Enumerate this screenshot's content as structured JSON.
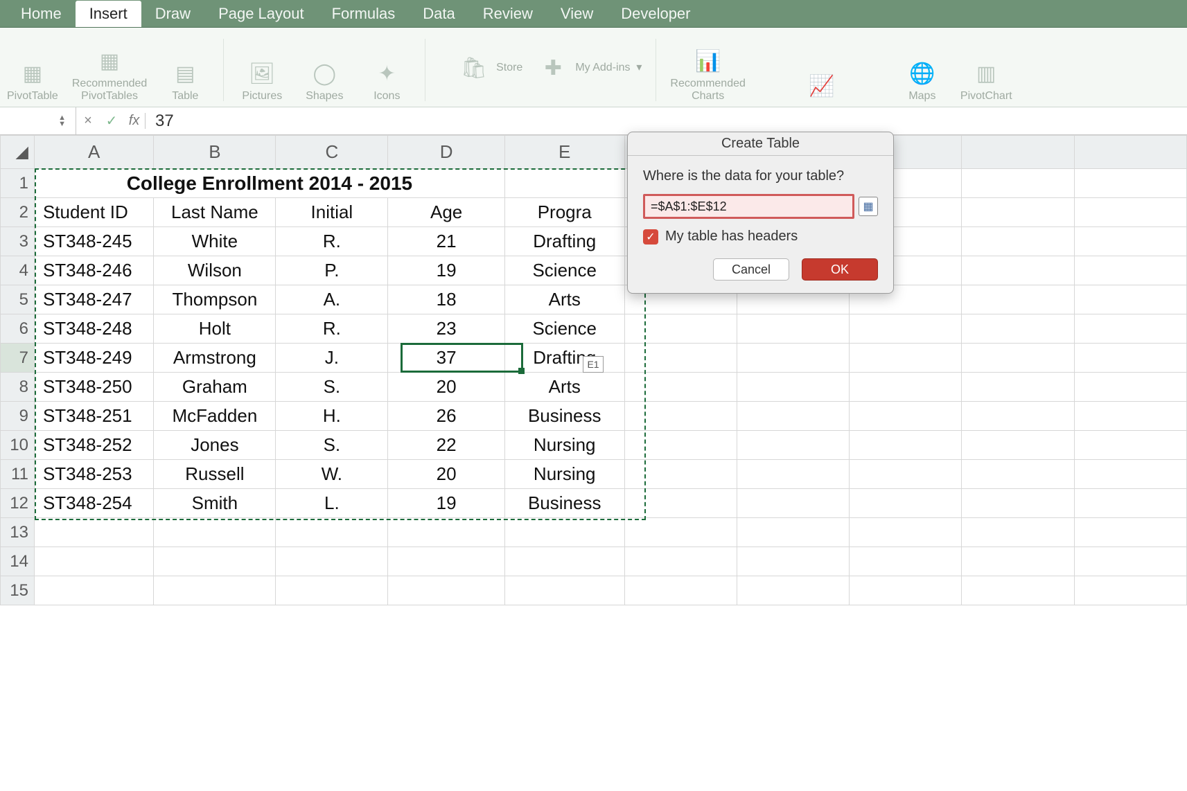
{
  "tabs": {
    "items": [
      "Home",
      "Insert",
      "Draw",
      "Page Layout",
      "Formulas",
      "Data",
      "Review",
      "View",
      "Developer"
    ],
    "active": "Insert"
  },
  "ribbon_groups": {
    "pivot_table": "PivotTable",
    "rec_pivot": "Recommended\nPivotTables",
    "table": "Table",
    "pictures": "Pictures",
    "shapes": "Shapes",
    "icons": "Icons",
    "store": "Store",
    "addins": "My Add-ins  ▾",
    "rec_charts": "Recommended\nCharts",
    "maps": "Maps",
    "pivot_chart": "PivotChart"
  },
  "formula_bar": {
    "fx": "fx",
    "value": "37",
    "cancel_glyph": "×",
    "enter_glyph": "✓"
  },
  "columns": [
    "A",
    "B",
    "C",
    "D",
    "E"
  ],
  "row_headers": [
    "1",
    "2",
    "3",
    "4",
    "5",
    "6",
    "7",
    "8",
    "9",
    "10",
    "11",
    "12",
    "13",
    "14",
    "15"
  ],
  "title_row": "College Enrollment 2014 - 2015",
  "headers": [
    "Student ID",
    "Last Name",
    "Initial",
    "Age",
    "Progra"
  ],
  "ref_chip": "E1",
  "rows": [
    {
      "id": "ST348-245",
      "last": "White",
      "init": "R.",
      "age": "21",
      "prog": "Drafting"
    },
    {
      "id": "ST348-246",
      "last": "Wilson",
      "init": "P.",
      "age": "19",
      "prog": "Science"
    },
    {
      "id": "ST348-247",
      "last": "Thompson",
      "init": "A.",
      "age": "18",
      "prog": "Arts"
    },
    {
      "id": "ST348-248",
      "last": "Holt",
      "init": "R.",
      "age": "23",
      "prog": "Science"
    },
    {
      "id": "ST348-249",
      "last": "Armstrong",
      "init": "J.",
      "age": "37",
      "prog": "Drafting"
    },
    {
      "id": "ST348-250",
      "last": "Graham",
      "init": "S.",
      "age": "20",
      "prog": "Arts"
    },
    {
      "id": "ST348-251",
      "last": "McFadden",
      "init": "H.",
      "age": "26",
      "prog": "Business"
    },
    {
      "id": "ST348-252",
      "last": "Jones",
      "init": "S.",
      "age": "22",
      "prog": "Nursing"
    },
    {
      "id": "ST348-253",
      "last": "Russell",
      "init": "W.",
      "age": "20",
      "prog": "Nursing"
    },
    {
      "id": "ST348-254",
      "last": "Smith",
      "init": "L.",
      "age": "19",
      "prog": "Business"
    }
  ],
  "dialog": {
    "title": "Create Table",
    "prompt": "Where is the data for your table?",
    "range": "=$A$1:$E$12",
    "checkbox_label": "My table has headers",
    "checkbox_checked": true,
    "cancel": "Cancel",
    "ok": "OK"
  }
}
